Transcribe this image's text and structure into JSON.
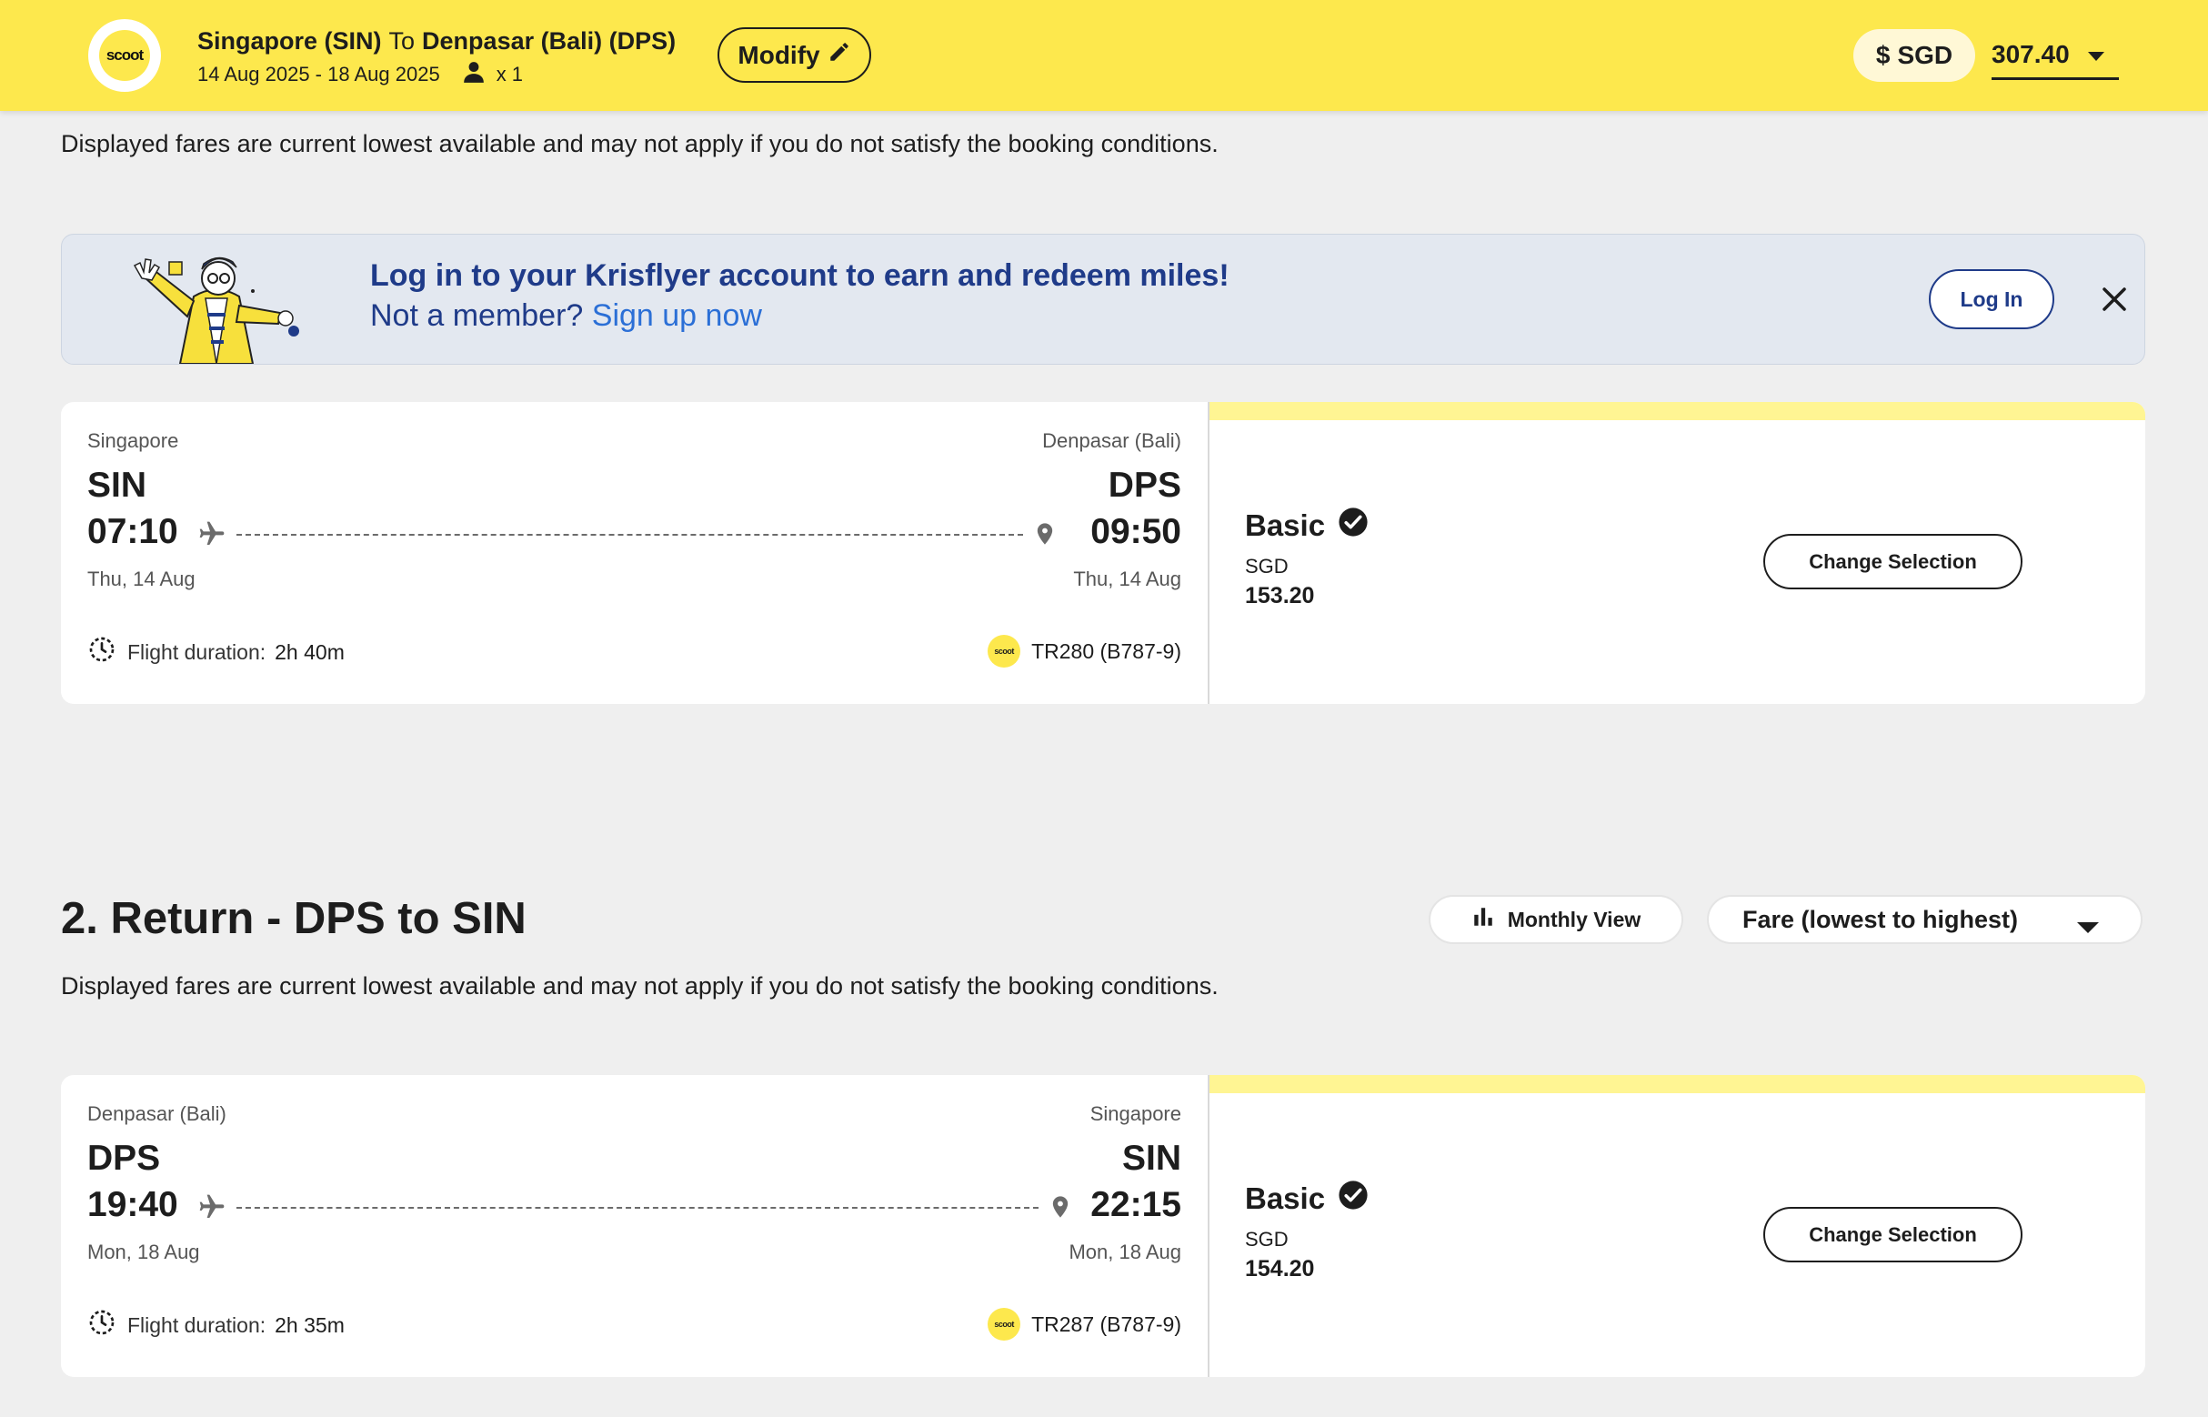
{
  "header": {
    "logo_text": "scoot",
    "origin": "Singapore (SIN)",
    "to_word": "To",
    "destination": "Denpasar (Bali) (DPS)",
    "dates": "14 Aug 2025 - 18 Aug 2025",
    "passengers": "x 1",
    "modify_label": "Modify",
    "currency_symbol": "$",
    "currency": "SGD",
    "total_price": "307.40"
  },
  "disclaimer_text": "Displayed fares are current lowest available and may not apply if you do not satisfy the booking conditions.",
  "krisflyer": {
    "title": "Log in to your Krisflyer account to earn and redeem miles!",
    "not_member": "Not a member?",
    "signup": "Sign up now",
    "login_label": "Log In"
  },
  "outbound": {
    "from_city": "Singapore",
    "to_city": "Denpasar (Bali)",
    "from_code": "SIN",
    "to_code": "DPS",
    "depart_time": "07:10",
    "arrive_time": "09:50",
    "depart_date": "Thu, 14 Aug",
    "arrive_date": "Thu, 14 Aug",
    "duration_label": "Flight duration:",
    "duration": "2h 40m",
    "logo_text": "scoot",
    "flight_no": "TR280",
    "aircraft": "(B787-9)",
    "fare_name": "Basic",
    "fare_currency": "SGD",
    "fare_amount": "153.20",
    "change_label": "Change Selection"
  },
  "return_section": {
    "title": "2. Return - DPS to SIN",
    "monthly_view_label": "Monthly View",
    "sort_label": "Fare (lowest to highest)"
  },
  "return": {
    "from_city": "Denpasar (Bali)",
    "to_city": "Singapore",
    "from_code": "DPS",
    "to_code": "SIN",
    "depart_time": "19:40",
    "arrive_time": "22:15",
    "depart_date": "Mon, 18 Aug",
    "arrive_date": "Mon, 18 Aug",
    "duration_label": "Flight duration:",
    "duration": "2h 35m",
    "logo_text": "scoot",
    "flight_no": "TR287",
    "aircraft": "(B787-9)",
    "fare_name": "Basic",
    "fare_currency": "SGD",
    "fare_amount": "154.20",
    "change_label": "Change Selection"
  },
  "colors": {
    "brand_yellow": "#fde84d",
    "krisflyer_navy": "#1f3b89",
    "link_blue": "#2b6fd6",
    "fare_strip": "#fff593"
  },
  "icons": [
    "person-icon",
    "pencil-icon",
    "chevron-down-icon",
    "close-icon",
    "plane-icon",
    "location-pin-icon",
    "clock-icon",
    "check-circle-icon",
    "bar-chart-icon"
  ]
}
